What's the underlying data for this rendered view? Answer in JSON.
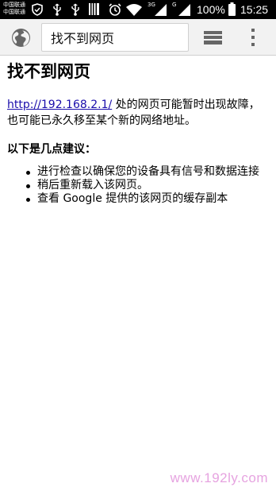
{
  "status_bar": {
    "carrier_top": "中国联通",
    "carrier_bottom": "中国联通",
    "network_3g": "3G",
    "network_g": "G",
    "battery": "100%",
    "time": "15:25",
    "icons": [
      "shield-icon",
      "usb-icon",
      "usb-icon",
      "barcode-icon",
      "alarm-icon",
      "wifi-icon",
      "signal-icon",
      "signal-icon",
      "battery-icon"
    ]
  },
  "toolbar": {
    "omnibox_text": "找不到网页",
    "icons": [
      "globe-icon",
      "tabs-icon",
      "overflow-menu-icon"
    ]
  },
  "page": {
    "title": "找不到网页",
    "url_link": "http://192.168.2.1/",
    "message": " 处的网页可能暂时出现故障，也可能已永久移至某个新的网络地址。",
    "suggestions_heading": "以下是几点建议：",
    "suggestions": [
      "进行检查以确保您的设备具有信号和数据连接",
      "稍后重新载入该网页。",
      "查看 Google 提供的该网页的缓存副本"
    ]
  },
  "watermark": "www.192ly.com",
  "colors": {
    "status_bar_bg": "#000000",
    "toolbar_bg": "#f2f2f2",
    "link": "#1a0dab",
    "watermark": "#e6a3e0"
  }
}
